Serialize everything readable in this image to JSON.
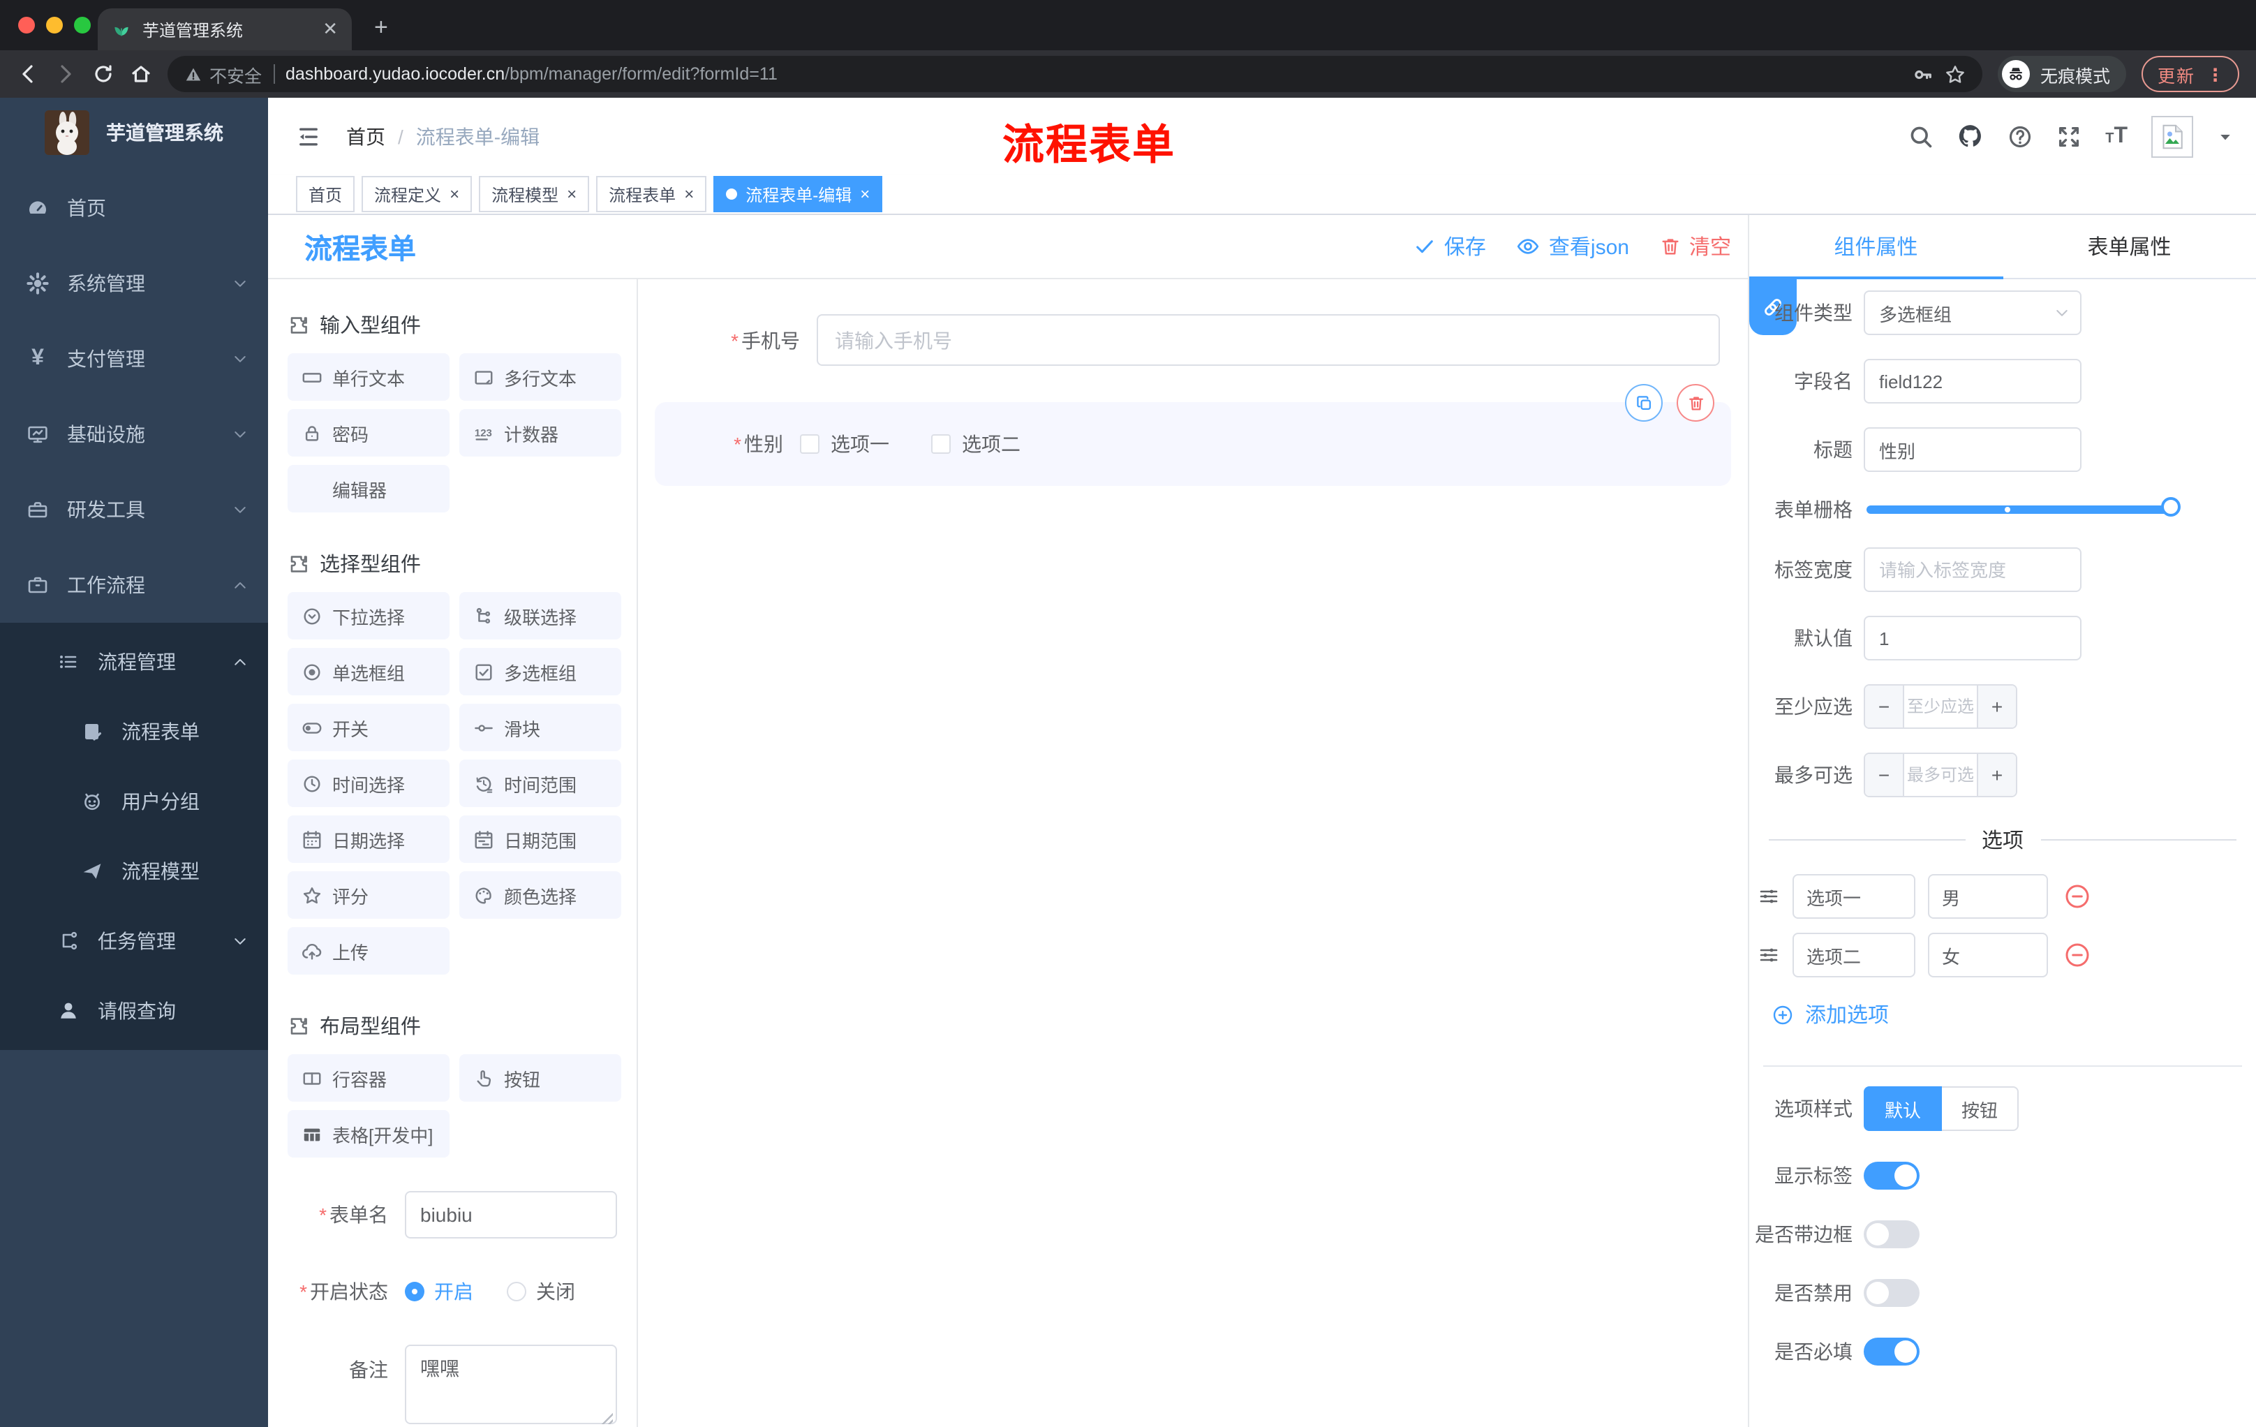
{
  "browser": {
    "tab_title": "芋道管理系统",
    "security_label": "不安全",
    "url_host": "dashboard.yudao.iocoder.cn",
    "url_path": "/bpm/manager/form/edit?formId=11",
    "incognito_label": "无痕模式",
    "update_label": "更新"
  },
  "sidebar": {
    "title": "芋道管理系统",
    "items": [
      {
        "label": "首页"
      },
      {
        "label": "系统管理"
      },
      {
        "label": "支付管理"
      },
      {
        "label": "基础设施"
      },
      {
        "label": "研发工具"
      },
      {
        "label": "工作流程"
      }
    ],
    "sub_items": [
      {
        "label": "流程管理"
      },
      {
        "label": "流程表单"
      },
      {
        "label": "用户分组"
      },
      {
        "label": "流程模型"
      },
      {
        "label": "任务管理"
      },
      {
        "label": "请假查询"
      }
    ]
  },
  "header": {
    "breadcrumb_home": "首页",
    "breadcrumb_current": "流程表单-编辑",
    "annotation": "流程表单"
  },
  "tags": [
    {
      "label": "首页"
    },
    {
      "label": "流程定义"
    },
    {
      "label": "流程模型"
    },
    {
      "label": "流程表单"
    },
    {
      "label": "流程表单-编辑"
    }
  ],
  "designer": {
    "page_title": "流程表单",
    "save_label": "保存",
    "view_json_label": "查看json",
    "clear_label": "清空",
    "section_input_title": "输入型组件",
    "section_select_title": "选择型组件",
    "section_layout_title": "布局型组件",
    "components_input": [
      "单行文本",
      "多行文本",
      "密码",
      "计数器",
      "编辑器"
    ],
    "components_select": [
      "下拉选择",
      "级联选择",
      "单选框组",
      "多选框组",
      "开关",
      "滑块",
      "时间选择",
      "时间范围",
      "日期选择",
      "日期范围",
      "评分",
      "颜色选择",
      "上传"
    ],
    "components_layout": [
      "行容器",
      "按钮",
      "表格[开发中]"
    ],
    "form_name_label": "表单名",
    "form_name_value": "biubiu",
    "status_label": "开启状态",
    "status_on": "开启",
    "status_off": "关闭",
    "remark_label": "备注",
    "remark_value": "嘿嘿"
  },
  "canvas": {
    "phone_label": "手机号",
    "phone_placeholder": "请输入手机号",
    "gender_label": "性别",
    "gender_opt1": "选项一",
    "gender_opt2": "选项二"
  },
  "props": {
    "tab_component": "组件属性",
    "tab_form": "表单属性",
    "type_label": "组件类型",
    "type_value": "多选框组",
    "field_label": "字段名",
    "field_value": "field122",
    "title_label": "标题",
    "title_value": "性别",
    "grid_label": "表单栅格",
    "label_width_label": "标签宽度",
    "label_width_placeholder": "请输入标签宽度",
    "default_label": "默认值",
    "default_value": "1",
    "min_label": "至少应选",
    "min_placeholder": "至少应选",
    "max_label": "最多可选",
    "max_placeholder": "最多可选",
    "options_title": "选项",
    "options": [
      {
        "label": "选项一",
        "value": "男"
      },
      {
        "label": "选项二",
        "value": "女"
      }
    ],
    "add_option_label": "添加选项",
    "style_label": "选项样式",
    "style_default": "默认",
    "style_button": "按钮",
    "toggle_show_label": "显示标签",
    "toggle_border_label": "是否带边框",
    "toggle_disabled_label": "是否禁用",
    "toggle_required_label": "是否必填"
  },
  "colors": {
    "primary": "#409eff",
    "danger": "#f56c6c"
  }
}
